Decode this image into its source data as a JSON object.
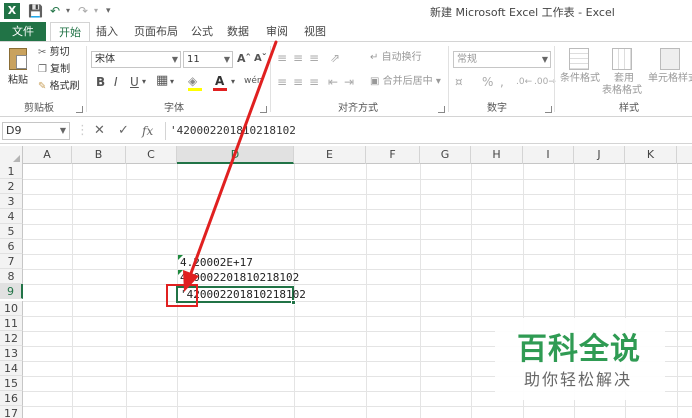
{
  "window": {
    "title": "新建 Microsoft Excel 工作表 - Excel",
    "app_icon": "excel-icon",
    "quick_access": [
      "save-icon",
      "undo-icon",
      "redo-icon",
      "customize-icon"
    ]
  },
  "tabs": [
    {
      "label": "文件"
    },
    {
      "label": "开始"
    },
    {
      "label": "插入"
    },
    {
      "label": "页面布局"
    },
    {
      "label": "公式"
    },
    {
      "label": "数据"
    },
    {
      "label": "审阅"
    },
    {
      "label": "视图"
    }
  ],
  "ribbon": {
    "clipboard": {
      "paste": "粘贴",
      "cut": "剪切",
      "copy": "复制",
      "format_painter": "格式刷",
      "label": "剪贴板"
    },
    "font": {
      "font_name": "宋体",
      "font_size": "11",
      "bold": "B",
      "italic": "I",
      "underline": "U",
      "font_color_glyph": "A",
      "phonetic": "wén",
      "label": "字体"
    },
    "alignment": {
      "wrap": "自动换行",
      "merge": "合并后居中",
      "label": "对齐方式"
    },
    "number": {
      "format": "常规",
      "percent": "%",
      "comma": ",",
      "label": "数字"
    },
    "styles": {
      "conditional": "条件格式",
      "table_format_1": "套用",
      "table_format_2": "表格格式",
      "cell_styles": "单元格样式",
      "label": "样式"
    }
  },
  "formula_bar": {
    "name_box": "D9",
    "cancel": "✕",
    "enter": "✓",
    "fx": "fx",
    "content": "'420002201810218102"
  },
  "grid": {
    "columns": [
      "A",
      "B",
      "C",
      "D",
      "E",
      "F",
      "G",
      "H",
      "I",
      "J",
      "K"
    ],
    "selected_column": "D",
    "rows": [
      "1",
      "2",
      "3",
      "4",
      "5",
      "6",
      "7",
      "8",
      "9",
      "10",
      "11",
      "12",
      "13",
      "14",
      "15",
      "16",
      "17"
    ],
    "selected_row": "9",
    "cells": {
      "D7": "4.20002E+17",
      "D8": "420002201810218102",
      "D9": "'420002201810218102"
    }
  },
  "watermark": {
    "title": "百科全说",
    "subtitle": "助你轻松解决"
  },
  "colors": {
    "accent": "#217346",
    "annotation": "#e02020",
    "watermark": "#2f9b53"
  }
}
